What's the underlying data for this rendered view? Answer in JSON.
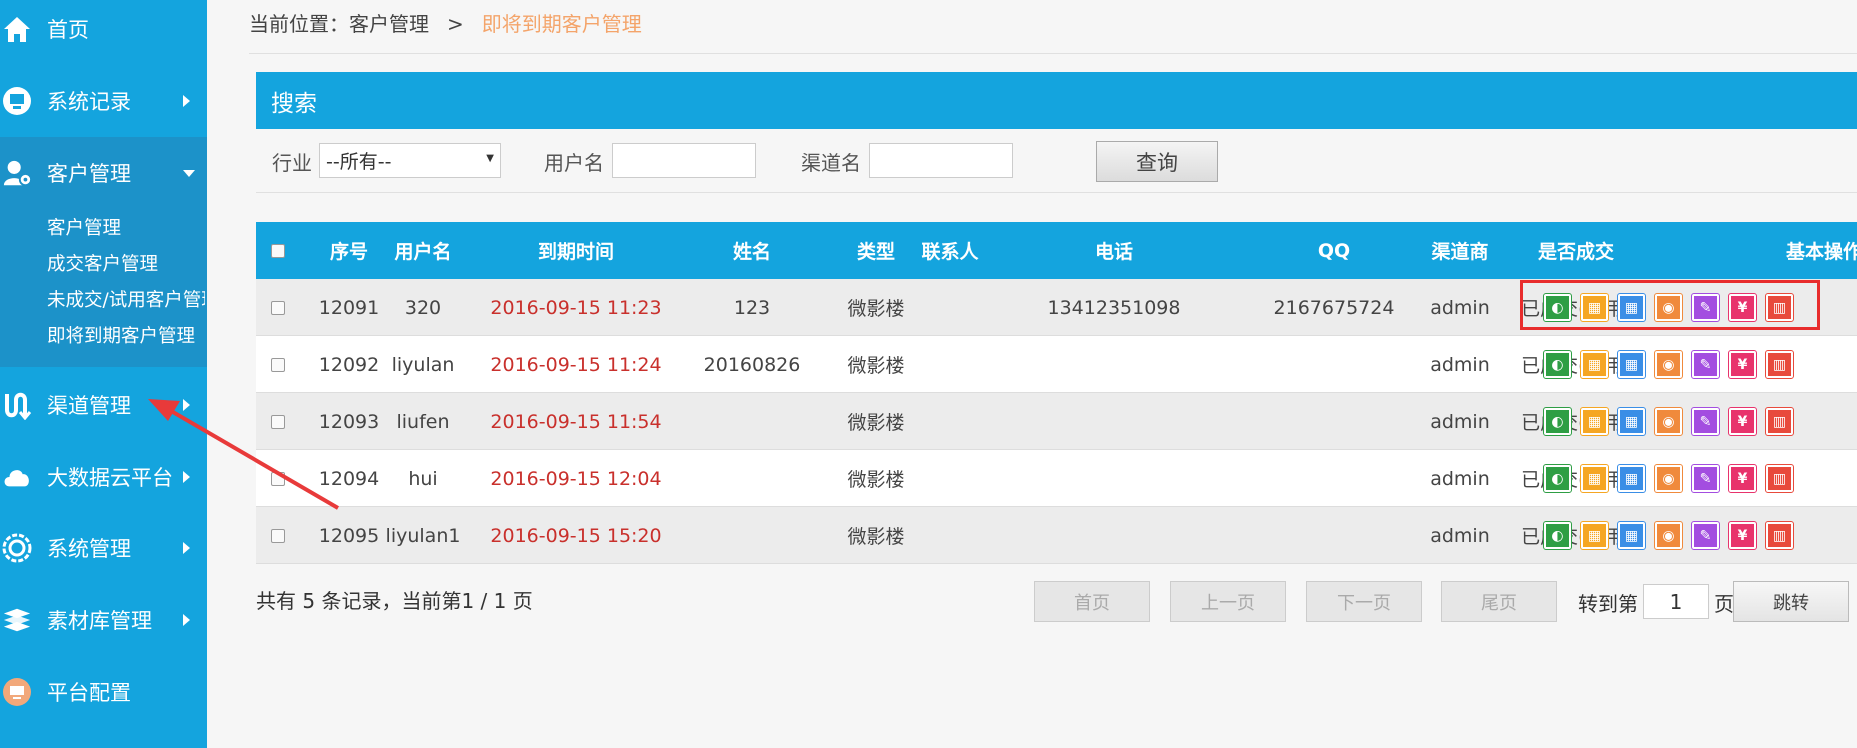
{
  "sidebar": {
    "items": [
      {
        "label": "首页",
        "icon": "home-icon"
      },
      {
        "label": "系统记录",
        "icon": "monitor-icon"
      },
      {
        "label": "客户管理",
        "icon": "user-settings-icon"
      },
      {
        "label": "渠道管理",
        "icon": "channel-icon"
      },
      {
        "label": "大数据云平台",
        "icon": "cloud-icon"
      },
      {
        "label": "系统管理",
        "icon": "gear-icon"
      },
      {
        "label": "素材库管理",
        "icon": "layers-icon"
      },
      {
        "label": "平台配置",
        "icon": "config-icon"
      }
    ],
    "sub_items": [
      "客户管理",
      "成交客户管理",
      "未成交/试用客户管理",
      "即将到期客户管理"
    ]
  },
  "breadcrumb": {
    "prefix": "当前位置：客户管理",
    "separator": ">",
    "current": "即将到期客户管理"
  },
  "search": {
    "title": "搜索",
    "industry_label": "行业",
    "industry_value": "--所有--",
    "username_label": "用户名",
    "channel_label": "渠道名",
    "query_button": "查询"
  },
  "table": {
    "headers": [
      "序号",
      "用户名",
      "到期时间",
      "姓名",
      "类型",
      "联系人",
      "电话",
      "QQ",
      "渠道商",
      "是否成交",
      "基本操作"
    ],
    "rows": [
      {
        "id": "12091",
        "username": "320",
        "expire": "2016-09-15 11:23",
        "name": "123",
        "type": "微影楼",
        "contact": "",
        "phone": "13412351098",
        "qq": "2167675724",
        "channel": "admin",
        "deal": "已成交(试用)"
      },
      {
        "id": "12092",
        "username": "liyulan",
        "expire": "2016-09-15 11:24",
        "name": "20160826",
        "type": "微影楼",
        "contact": "",
        "phone": "",
        "qq": "",
        "channel": "admin",
        "deal": "已成交(试用)"
      },
      {
        "id": "12093",
        "username": "liufen",
        "expire": "2016-09-15 11:54",
        "name": "",
        "type": "微影楼",
        "contact": "",
        "phone": "",
        "qq": "",
        "channel": "admin",
        "deal": "已成交(试用)"
      },
      {
        "id": "12094",
        "username": "hui",
        "expire": "2016-09-15 12:04",
        "name": "",
        "type": "微影楼",
        "contact": "",
        "phone": "",
        "qq": "",
        "channel": "admin",
        "deal": "已成交(试用)"
      },
      {
        "id": "12095",
        "username": "liyulan1",
        "expire": "2016-09-15 15:20",
        "name": "",
        "type": "微影楼",
        "contact": "",
        "phone": "",
        "qq": "",
        "channel": "admin",
        "deal": "已成交(试用)"
      }
    ],
    "op_icons": [
      {
        "name": "toggle-icon",
        "color": "#2e9e44",
        "glyph": "◐"
      },
      {
        "name": "film-icon",
        "color": "#f5a623",
        "glyph": "▦"
      },
      {
        "name": "grid-icon",
        "color": "#3a8ee6",
        "glyph": "▦"
      },
      {
        "name": "eye-icon",
        "color": "#f08a3c",
        "glyph": "◉"
      },
      {
        "name": "edit-icon",
        "color": "#a34de0",
        "glyph": "✎"
      },
      {
        "name": "yen-icon",
        "color": "#e8336c",
        "glyph": "¥"
      },
      {
        "name": "trash-icon",
        "color": "#e84a3c",
        "glyph": "▥"
      }
    ]
  },
  "pagination": {
    "summary": "共有 5 条记录，当前第1 / 1 页",
    "first": "首页",
    "prev": "上一页",
    "next": "下一页",
    "last": "尾页",
    "goto_label": "转到第",
    "goto_value": "1",
    "page_suffix": "页",
    "jump": "跳转"
  },
  "colors": {
    "primary": "#14a4de",
    "sidebar_sub": "#1c92c9",
    "date_red": "#c9302c",
    "breadcrumb_current": "#f4a46a",
    "highlight": "#e82c2c"
  }
}
